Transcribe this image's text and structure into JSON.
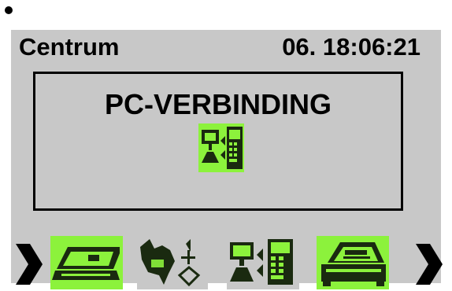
{
  "header": {
    "location": "Centrum",
    "datetime": "06. 18:06:21"
  },
  "dialog": {
    "title": "PC-VERBINDING",
    "icon": "pc-connection-icon"
  },
  "menu": {
    "items": [
      {
        "icon": "scale-icon"
      },
      {
        "icon": "bird-icon"
      },
      {
        "icon": "pc-connection-icon"
      },
      {
        "icon": "printer-icon"
      }
    ],
    "nav_left_icon": "chevron-left-icon",
    "nav_right_icon": "chevron-right-icon"
  },
  "colors": {
    "lcd_background": "#c8c8c8",
    "icon_highlight": "#8cf23c",
    "pixel_dark": "#1a2a10"
  }
}
